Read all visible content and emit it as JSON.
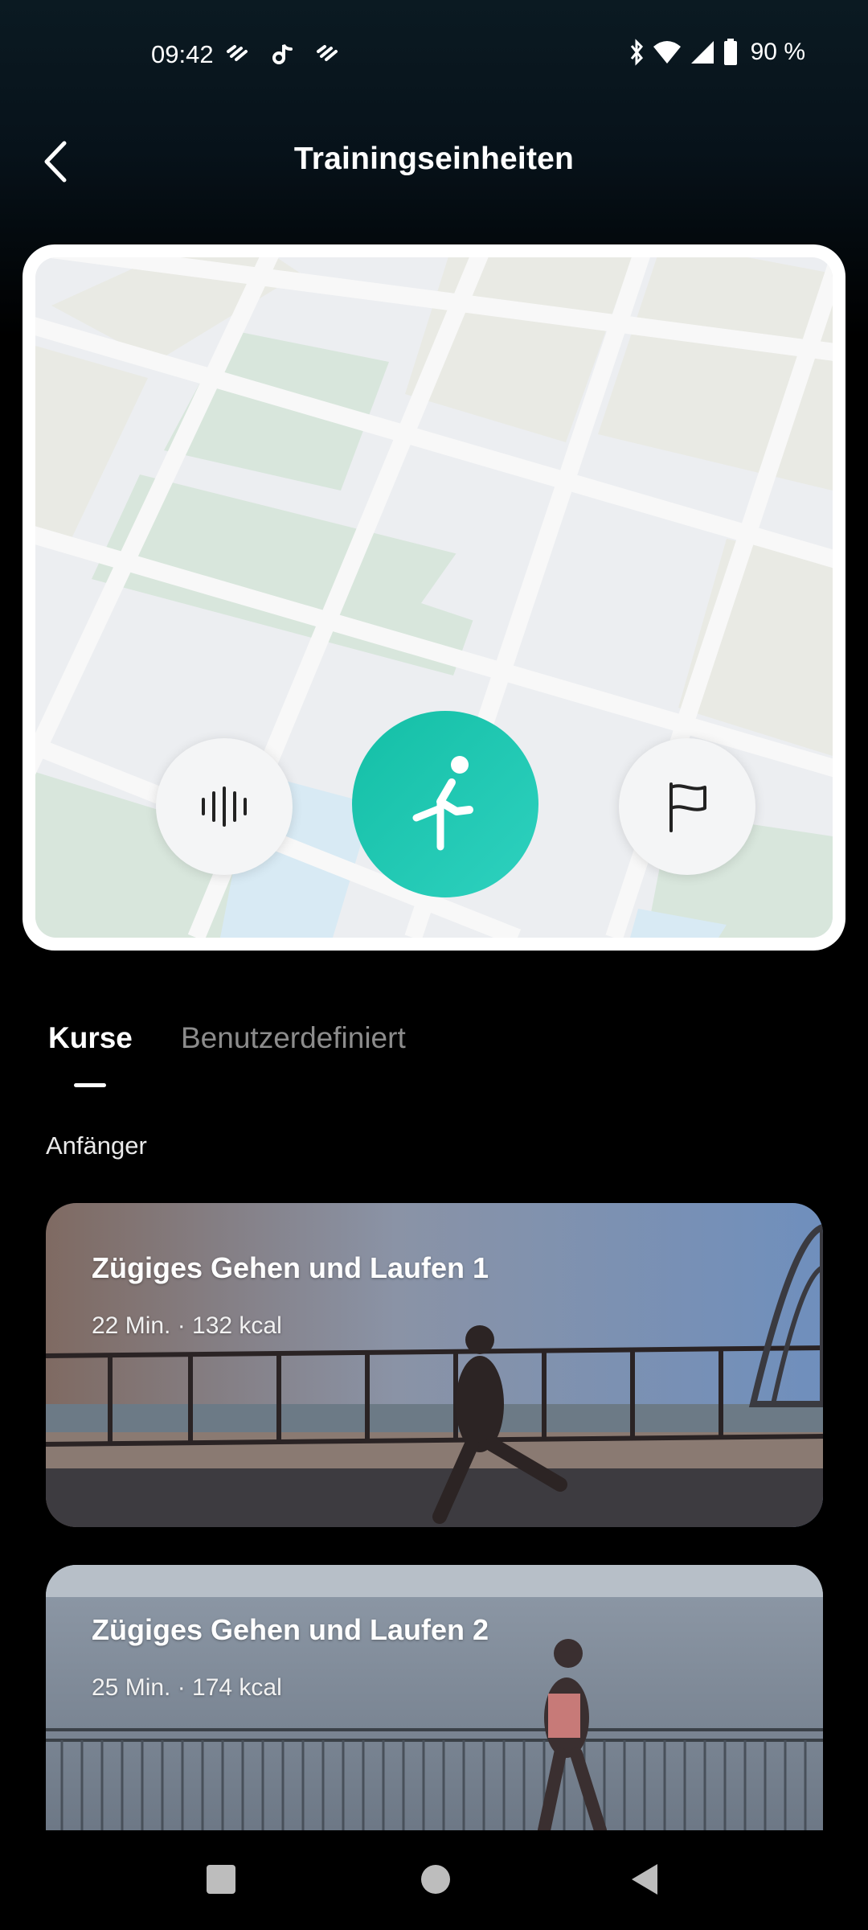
{
  "status_bar": {
    "time": "09:42",
    "battery": "90 %",
    "left_icons": [
      "notification-icon",
      "tiktok-icon",
      "notification-icon"
    ],
    "right_icons": [
      "bluetooth-icon",
      "wifi-icon",
      "signal-icon",
      "battery-icon"
    ]
  },
  "header": {
    "title": "Trainingseinheiten",
    "back_icon": "chevron-left-icon"
  },
  "map_controls": {
    "left": "audio-icon",
    "center": "run-icon",
    "right": "flag-icon",
    "accent": "#1cc8b0"
  },
  "tabs": [
    {
      "label": "Kurse",
      "active": true
    },
    {
      "label": "Benutzerdefiniert",
      "active": false
    }
  ],
  "section_title": "Anfänger",
  "courses": [
    {
      "title": "Zügiges Gehen und Laufen 1",
      "meta": "22 Min. · 132 kcal"
    },
    {
      "title": "Zügiges Gehen und Laufen 2",
      "meta": "25 Min. · 174 kcal"
    }
  ],
  "nav_bar": [
    "recents-button",
    "home-button",
    "back-button"
  ]
}
